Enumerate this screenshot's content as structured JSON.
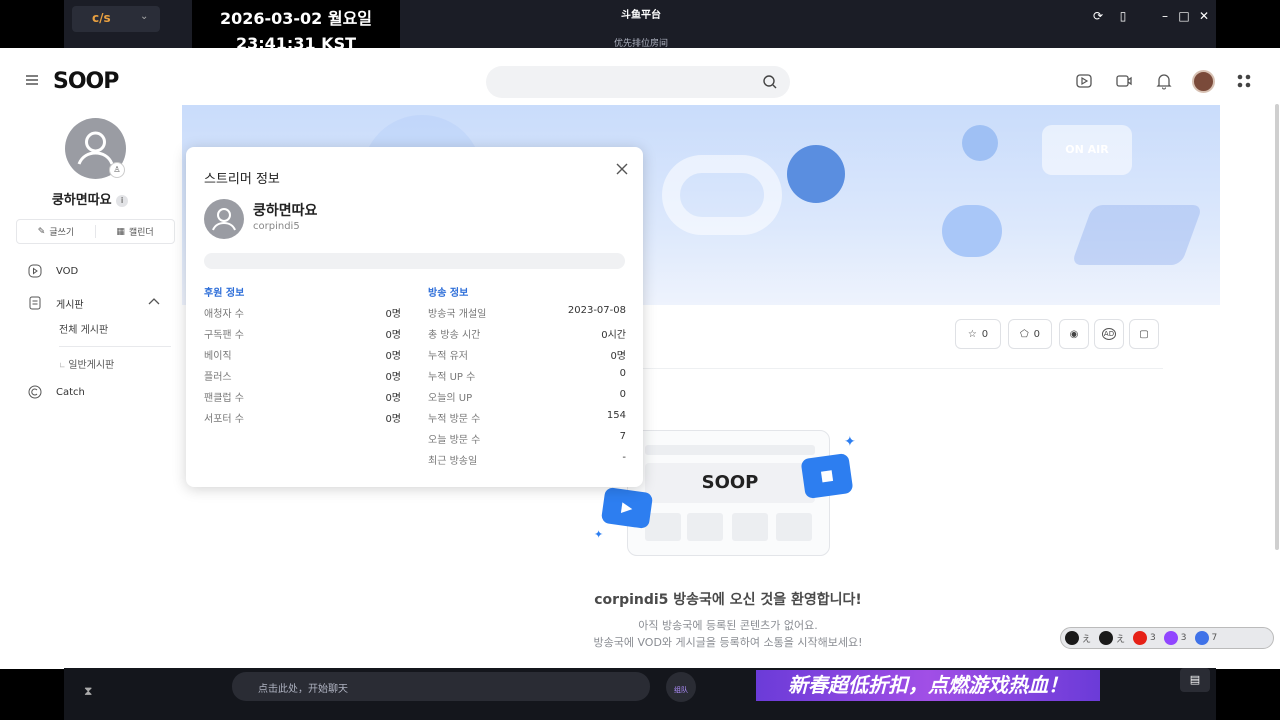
{
  "outer": {
    "app_logo": "c/s",
    "clock_date": "2026-03-02 월요일",
    "clock_time": "23:41:31 KST",
    "brand": "斗鱼平台",
    "sub_label": "优先排位房间",
    "chat_placeholder": "点击此处，开始聊天",
    "bottom_icon_label": "组队",
    "promo_banner": "新春超低折扣，点燃游戏热血！"
  },
  "header": {
    "logo": "SOOP",
    "search_placeholder": ""
  },
  "sidebar": {
    "name": "쿵하면따요",
    "actions": [
      {
        "label": "글쓰기",
        "icon": "pencil-icon"
      },
      {
        "label": "캘린더",
        "icon": "calendar-icon"
      }
    ],
    "nav": [
      {
        "label": "VOD",
        "icon": "play-icon"
      },
      {
        "label": "게시판",
        "icon": "board-icon"
      },
      {
        "label": "Catch",
        "icon": "catch-icon"
      }
    ],
    "board_all": "전체 게시판",
    "board_general": "일반게시판"
  },
  "stats_buttons": [
    {
      "icon": "star-icon",
      "count": "0"
    },
    {
      "icon": "badge-icon",
      "count": "0"
    },
    {
      "icon": "pin-icon",
      "count": ""
    },
    {
      "icon": "ad-icon",
      "count": ""
    },
    {
      "icon": "note-icon",
      "count": ""
    }
  ],
  "welcome": {
    "title": "corpindi5 방송국에 오신 것을 환영합니다!",
    "line1": "아직 방송국에 등록된 콘텐츠가 없어요.",
    "line2": "방송국에 VOD와 게시글을 등록하여 소통을 시작해보세요!",
    "illustration_logo": "SOOP"
  },
  "popup": {
    "title": "스트리머 정보",
    "name": "쿵하면따요",
    "id": "corpindi5",
    "support_title": "후원 정보",
    "support": [
      {
        "label": "애청자 수",
        "value": "0명"
      },
      {
        "label": "구독팬 수",
        "value": "0명"
      },
      {
        "label": "베이직",
        "value": "0명"
      },
      {
        "label": "플러스",
        "value": "0명"
      },
      {
        "label": "팬클럽 수",
        "value": "0명"
      },
      {
        "label": "서포터 수",
        "value": "0명"
      }
    ],
    "broadcast_title": "방송 정보",
    "broadcast": [
      {
        "label": "방송국 개설일",
        "value": "2023-07-08"
      },
      {
        "label": "총 방송 시간",
        "value": "0시간"
      },
      {
        "label": "누적 유저",
        "value": "0명"
      },
      {
        "label": "누적 UP 수",
        "value": "0"
      },
      {
        "label": "오늘의 UP",
        "value": "0"
      },
      {
        "label": "누적 방문 수",
        "value": "154"
      },
      {
        "label": "오늘 방문 수",
        "value": "7"
      },
      {
        "label": "최근 방송일",
        "value": "-"
      }
    ]
  },
  "platforms": [
    {
      "icon": "soop-icon",
      "count": "え",
      "color": "#1a1a1a"
    },
    {
      "icon": "z-icon",
      "count": "え",
      "color": "#1a1a1a"
    },
    {
      "icon": "youtube-icon",
      "count": "3",
      "color": "#e62117"
    },
    {
      "icon": "twitch-icon",
      "count": "3",
      "color": "#9146ff"
    },
    {
      "icon": "we-icon",
      "count": "7",
      "color": "#3f72e8"
    }
  ]
}
